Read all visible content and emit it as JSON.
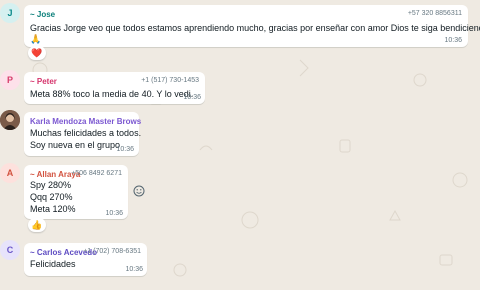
{
  "messages": [
    {
      "avatar": {
        "letter": "J",
        "bg": "#d5f0f0",
        "fg": "#0a8a8a"
      },
      "sender": "~ Jose",
      "sender_color": "#0b7f7a",
      "phone": "+57 320 8856311",
      "lines": [
        "Gracias Jorge veo que todos estamos aprendiendo mucho, gracias por enseñar con amor Dios te siga bendiciendo",
        "🙏"
      ],
      "time": "10:36",
      "reaction": "❤️"
    },
    {
      "avatar": {
        "letter": "P",
        "bg": "#fde1ea",
        "fg": "#d63d6c"
      },
      "sender": "~ Peter",
      "sender_color": "#d5336b",
      "phone": "+1 (517) 730-1453",
      "lines": [
        "Meta 88% toco la media de 40. Y lo vedi."
      ],
      "time": "10:36"
    },
    {
      "avatar": {
        "letter": "",
        "bg": "#6b4a3a",
        "fg": "#ffffff"
      },
      "sender": "Karla Mendoza Master Brows",
      "sender_color": "#7b57d1",
      "lines": [
        "Muchas felicidades a todos.",
        "Soy nueva en el grupo"
      ],
      "time": "10:36"
    },
    {
      "avatar": {
        "letter": "A",
        "bg": "#fde1dd",
        "fg": "#d2523f"
      },
      "sender": "~ Allan Araya",
      "sender_color": "#d2523f",
      "phone": "+506 8492 6271",
      "lines": [
        "Spy 280%",
        "Qqq 270%",
        "Meta 120%"
      ],
      "time": "10:36",
      "reaction": "👍",
      "side_icon": "smiley-icon"
    },
    {
      "avatar": {
        "letter": "C",
        "bg": "#e7e3fb",
        "fg": "#6a57c9"
      },
      "sender": "~ Carlos Acevedo",
      "sender_color": "#5e4cc2",
      "phone": "+1 (702) 708-6351",
      "lines": [
        "Felicidades"
      ],
      "time": "10:36"
    }
  ]
}
